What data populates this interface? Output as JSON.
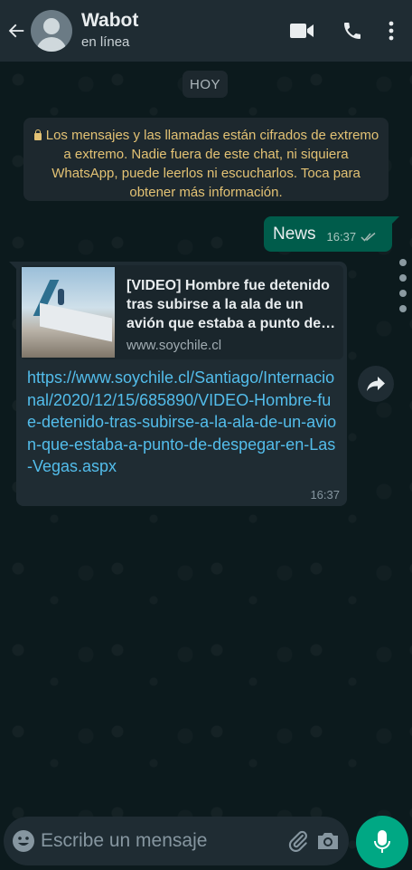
{
  "header": {
    "contact_name": "Wabot",
    "contact_status": "en línea",
    "icons": [
      "back-arrow-icon",
      "video-call-icon",
      "phone-icon",
      "more-options-icon"
    ]
  },
  "date_chip": "HOY",
  "encryption_notice": "Los mensajes y las llamadas están cifrados de extremo a extremo. Nadie fuera de este chat, ni siquiera WhatsApp, puede leerlos ni escucharlos. Toca para obtener más información.",
  "messages": [
    {
      "direction": "outgoing",
      "text": "News",
      "time": "16:37",
      "status": "read"
    },
    {
      "direction": "incoming",
      "link_preview": {
        "title": "[VIDEO] Hombre fue detenido tras subirse a la ala de un avión que estaba a punto de…",
        "domain": "www.soychile.cl"
      },
      "text": "https://www.soychile.cl/Santiago/Internacional/2020/12/15/685890/VIDEO-Hombre-fue-detenido-tras-subirse-a-la-ala-de-un-avion-que-estaba-a-punto-de-despegar-en-Las-Vegas.aspx",
      "time": "16:37"
    }
  ],
  "composer": {
    "placeholder": "Escribe un mensaje"
  },
  "colors": {
    "header_bg": "#1f2c33",
    "outgoing_bubble": "#005c4b",
    "incoming_bubble": "#1f2c33",
    "link": "#53bdeb",
    "notice_text": "#e3c274",
    "accent": "#00a884"
  }
}
